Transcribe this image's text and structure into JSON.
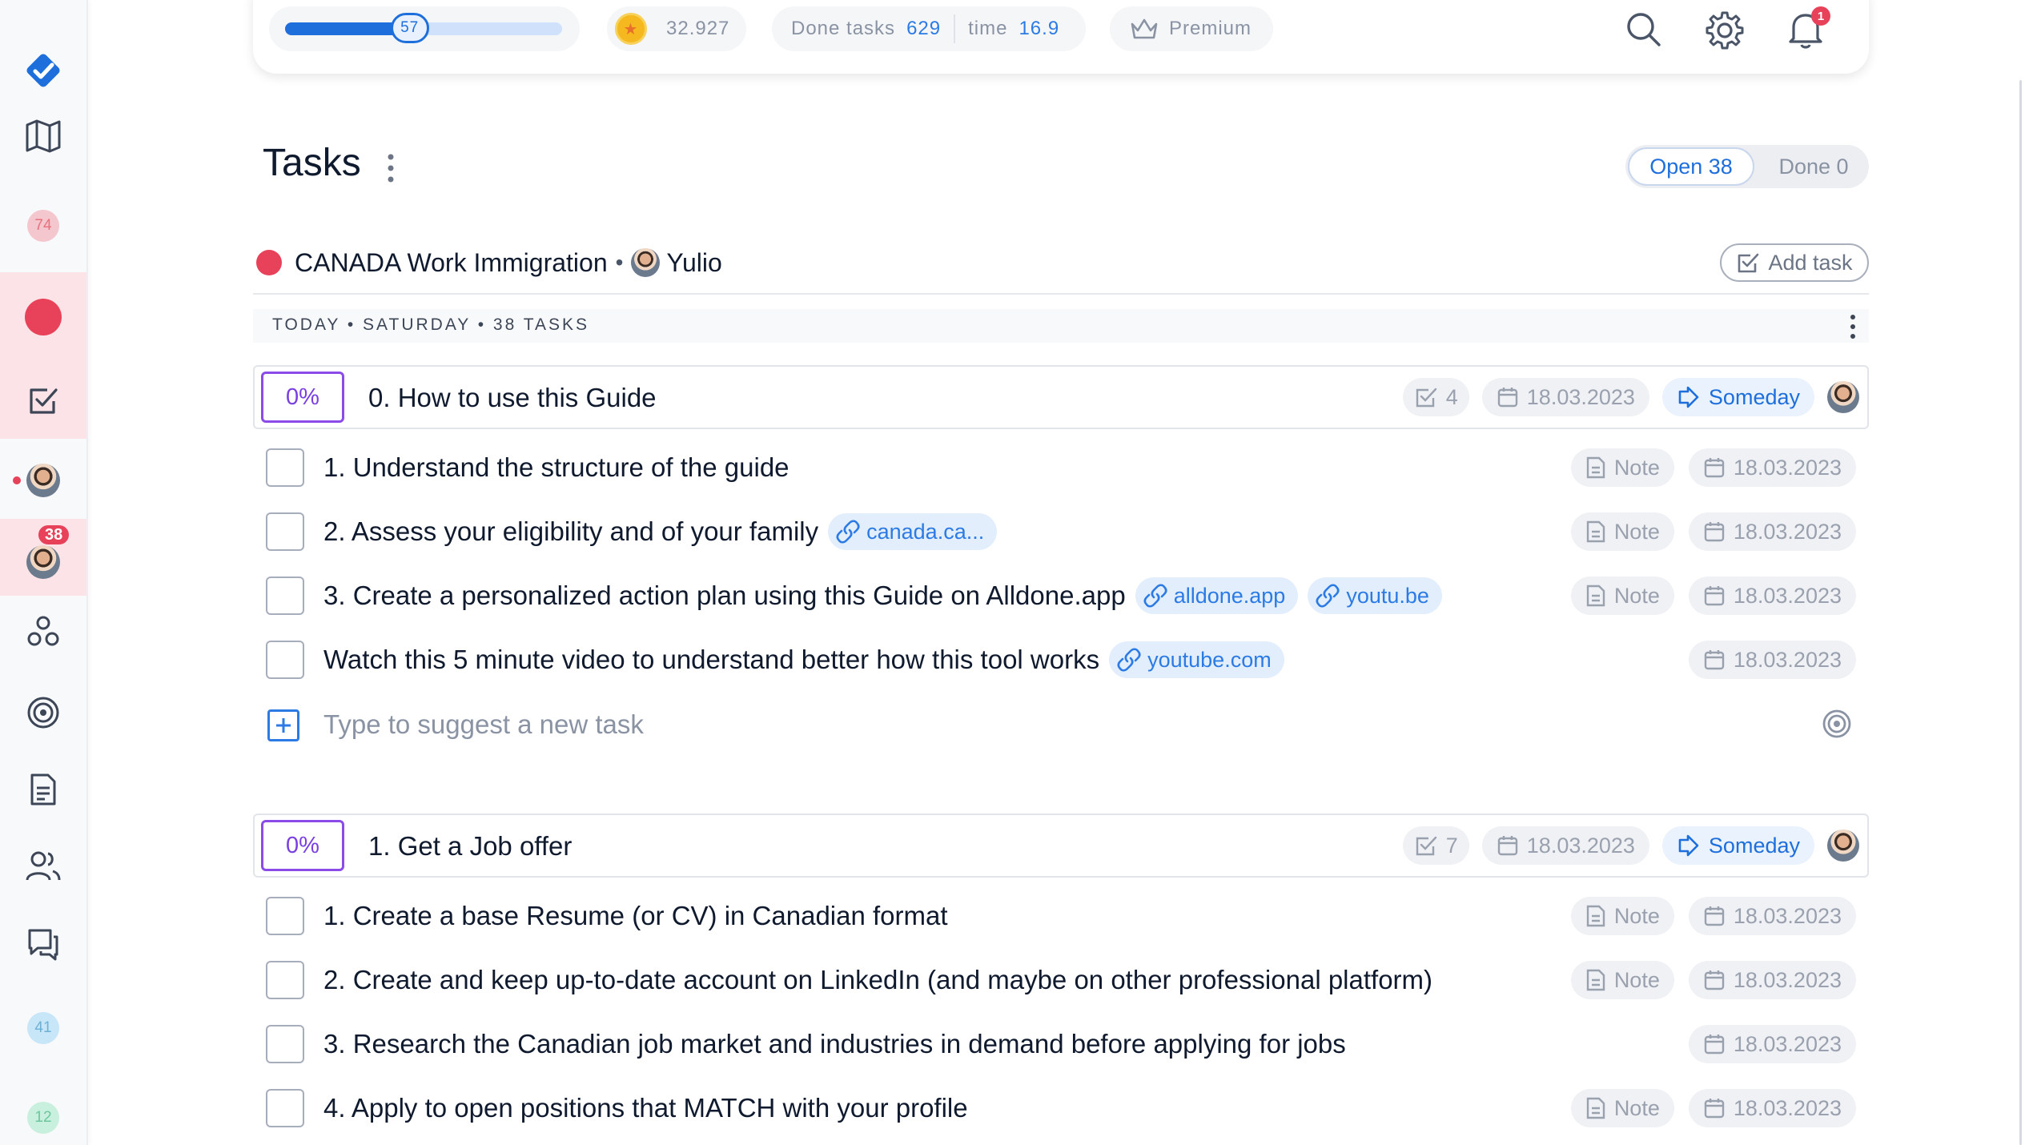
{
  "sidebar": {
    "counts": {
      "top": "74",
      "bottom1": "41",
      "bottom2": "12"
    },
    "avatar_badge": "38"
  },
  "topbar": {
    "progress": {
      "value": "57",
      "fraction": 0.45
    },
    "gold": "32.927",
    "done_tasks_label": "Done tasks",
    "done_tasks_value": "629",
    "time_label": "time",
    "time_value": "16.9",
    "premium_label": "Premium",
    "notifications_count": "1"
  },
  "page": {
    "title": "Tasks",
    "toggle": {
      "open": "Open 38",
      "done": "Done 0"
    }
  },
  "project": {
    "name": "CANADA Work Immigration",
    "separator": "•",
    "user": "Yulio",
    "add_task_label": "Add task",
    "day_header": "TODAY • SATURDAY • 38 TASKS"
  },
  "groups": [
    {
      "progress": "0%",
      "title": "0. How to use this Guide",
      "subtasks": "4",
      "date": "18.03.2023",
      "when": "Someday",
      "tasks": [
        {
          "text": "1. Understand the structure of the guide",
          "links": [],
          "note": "Note",
          "date": "18.03.2023"
        },
        {
          "text": "2. Assess your eligibility and of your family",
          "links": [
            "canada.ca..."
          ],
          "note": "Note",
          "date": "18.03.2023"
        },
        {
          "text": "3. Create a personalized action plan using this Guide on Alldone.app",
          "links": [
            "alldone.app",
            "youtu.be"
          ],
          "note": "Note",
          "date": "18.03.2023"
        },
        {
          "text": "Watch this 5 minute video to understand better how this tool works",
          "links": [
            "youtube.com"
          ],
          "note": "",
          "date": "18.03.2023"
        }
      ],
      "new_task_placeholder": "Type to suggest a new task"
    },
    {
      "progress": "0%",
      "title": "1. Get a Job offer",
      "subtasks": "7",
      "date": "18.03.2023",
      "when": "Someday",
      "tasks": [
        {
          "text": "1. Create a base Resume (or CV) in Canadian format",
          "note": "Note",
          "date": "18.03.2023"
        },
        {
          "text": "2. Create and keep up-to-date account on LinkedIn (and maybe on other professional platform)",
          "note": "Note",
          "date": "18.03.2023"
        },
        {
          "text": "3. Research the Canadian job market and industries in demand before applying for jobs",
          "note": "",
          "date": "18.03.2023"
        },
        {
          "text": "4. Apply to open positions that MATCH with your profile",
          "note": "Note",
          "date": "18.03.2023"
        }
      ]
    }
  ]
}
